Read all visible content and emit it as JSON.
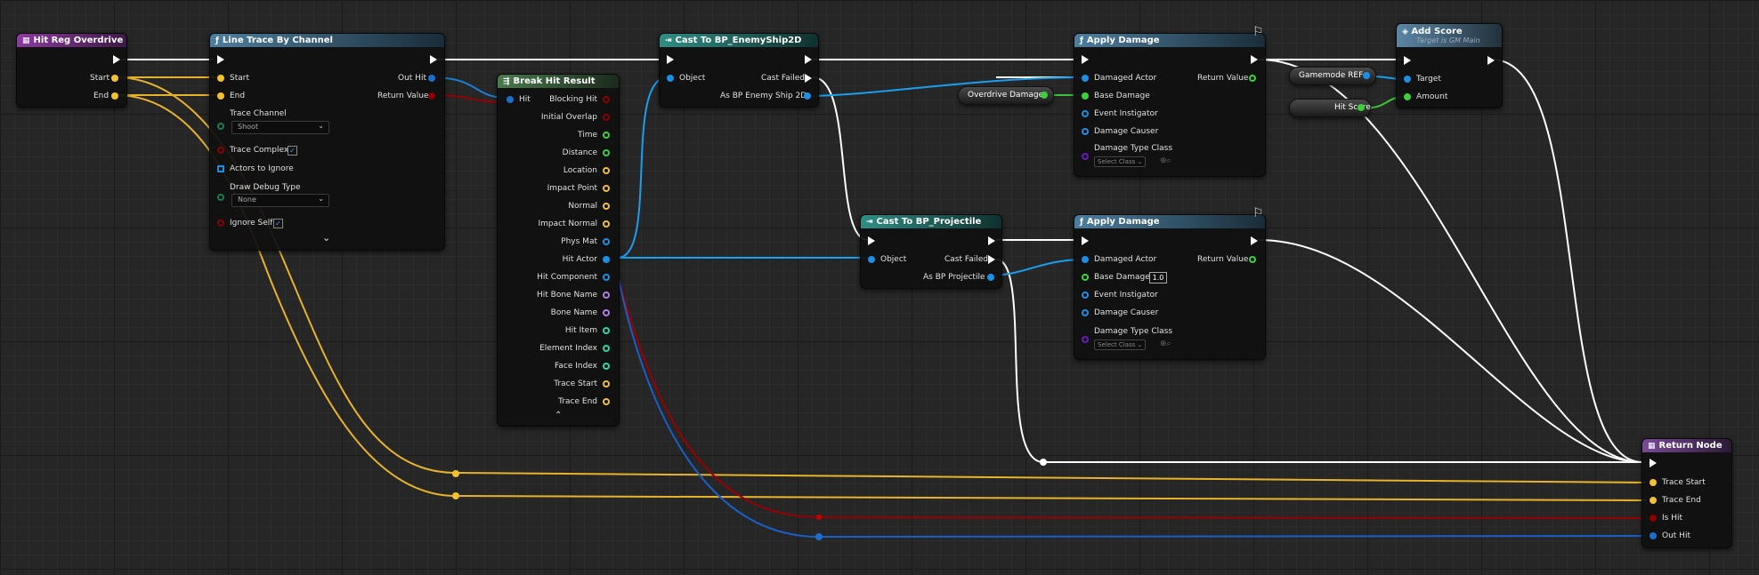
{
  "nodes": {
    "hit_reg": {
      "title": "Hit Reg Overdrive",
      "pins": [
        "Start",
        "End"
      ]
    },
    "line_trace": {
      "title": "Line Trace By Channel",
      "inputs": [
        "Start",
        "End"
      ],
      "outputs": [
        "Out Hit",
        "Return Value"
      ],
      "trace_channel_label": "Trace Channel",
      "trace_channel_value": "Shoot",
      "trace_complex": "Trace Complex",
      "actors_to_ignore": "Actors to Ignore",
      "draw_debug_label": "Draw Debug Type",
      "draw_debug_value": "None",
      "ignore_self": "Ignore Self",
      "check": "✓",
      "expand": "⌄"
    },
    "break_hit": {
      "title": "Break Hit Result",
      "input": "Hit",
      "outputs": [
        "Blocking Hit",
        "Initial Overlap",
        "Time",
        "Distance",
        "Location",
        "Impact Point",
        "Normal",
        "Impact Normal",
        "Phys Mat",
        "Hit Actor",
        "Hit Component",
        "Hit Bone Name",
        "Bone Name",
        "Hit Item",
        "Element Index",
        "Face Index",
        "Trace Start",
        "Trace End"
      ],
      "collapse": "⌃"
    },
    "cast_enemy": {
      "title": "Cast To BP_EnemyShip2D",
      "input": "Object",
      "outputs": [
        "Cast Failed",
        "As BP Enemy Ship 2D"
      ]
    },
    "cast_proj": {
      "title": "Cast To BP_Projectile",
      "input": "Object",
      "outputs": [
        "Cast Failed",
        "As BP Projectile"
      ]
    },
    "apply1": {
      "title": "Apply Damage",
      "inputs": [
        "Damaged Actor",
        "Base Damage",
        "Event Instigator",
        "Damage Causer",
        "Damage Type Class"
      ],
      "output": "Return Value",
      "select_class": "Select Class"
    },
    "apply2": {
      "title": "Apply Damage",
      "inputs": [
        "Damaged Actor",
        "Base Damage",
        "Event Instigator",
        "Damage Causer",
        "Damage Type Class"
      ],
      "base_damage_value": "1.0",
      "output": "Return Value",
      "select_class": "Select Class"
    },
    "add_score": {
      "title": "Add Score",
      "subtitle": "Target is GM Main",
      "inputs": [
        "Target",
        "Amount"
      ]
    },
    "return_node": {
      "title": "Return Node",
      "inputs": [
        "Trace Start",
        "Trace End",
        "Is Hit",
        "Out Hit"
      ]
    },
    "overdrive_damage": {
      "label": "Overdrive Damage"
    },
    "gamemode_ref": {
      "label": "Gamemode REF"
    },
    "hit_score": {
      "label": "Hit Score"
    }
  },
  "colors": {
    "exec": "#ffffff",
    "vector": "#f2c12e",
    "bool": "#8c0000",
    "object": "#1a8fe6",
    "struct": "#1a6fd0",
    "float": "#3ad13a",
    "name": "#b17ee8",
    "int": "#22d9a8",
    "class": "#6a1bbd"
  }
}
